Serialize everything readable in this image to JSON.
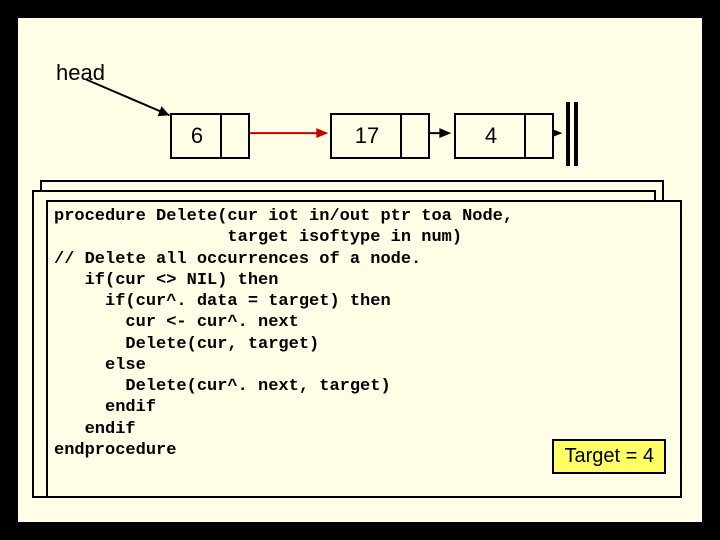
{
  "head_label": "head",
  "nodes": {
    "n1": "6",
    "n2": "17",
    "n3": "4"
  },
  "code": "procedure Delete(cur iot in/out ptr toa Node,\n                 target isoftype in num)\n// Delete all occurrences of a node.\n   if(cur <> NIL) then\n     if(cur^. data = target) then\n       cur <- cur^. next\n       Delete(cur, target)\n     else\n       Delete(cur^. next, target)\n     endif\n   endif\nendprocedure",
  "target_badge": "Target = 4"
}
